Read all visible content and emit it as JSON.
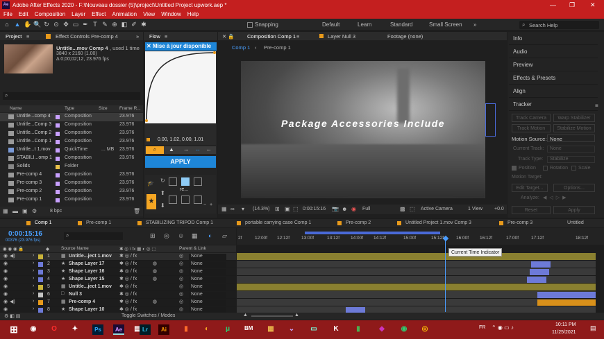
{
  "window": {
    "title": "Adobe After Effects 2020 - F:\\Nouveau dossier (5)\\project\\Untitled Project upwork.aep *"
  },
  "menu": [
    "File",
    "Edit",
    "Composition",
    "Layer",
    "Effect",
    "Animation",
    "View",
    "Window",
    "Help"
  ],
  "toolbar": {
    "snapping": "Snapping",
    "workspaces": [
      "Default",
      "Learn",
      "Standard",
      "Small Screen"
    ],
    "search_placeholder": "Search Help"
  },
  "project": {
    "tab": "Project",
    "effect_controls": "Effect Controls Pre-comp 4",
    "selected_name": "Untitle...mov Comp 4",
    "used": ", used 1 time",
    "dims": "3840 x 2160 (1.00)",
    "duration": "Δ 0;00;02;12, 23.976 fps",
    "columns": [
      "Name",
      "Type",
      "Size",
      "Frame R..."
    ],
    "items": [
      {
        "name": "Untitle...comp 4",
        "type": "Composition",
        "size": "",
        "fps": "23.976"
      },
      {
        "name": "Untitle...Comp 3",
        "type": "Composition",
        "size": "",
        "fps": "23.976"
      },
      {
        "name": "Untitle...Comp 2",
        "type": "Composition",
        "size": "",
        "fps": "23.976"
      },
      {
        "name": "Untitle...Comp 1",
        "type": "Composition",
        "size": "",
        "fps": "23.976"
      },
      {
        "name": "Untitle...t 1.mov",
        "type": "QuickTime",
        "size": "... MB",
        "fps": "23.976"
      },
      {
        "name": "STABILI...omp 1",
        "type": "Composition",
        "size": "",
        "fps": "23.976"
      },
      {
        "name": "Solids",
        "type": "Folder",
        "size": "",
        "fps": ""
      },
      {
        "name": "Pre-comp 4",
        "type": "Composition",
        "size": "",
        "fps": "23.976"
      },
      {
        "name": "Pre-comp 3",
        "type": "Composition",
        "size": "",
        "fps": "23.976"
      },
      {
        "name": "Pre-comp 2",
        "type": "Composition",
        "size": "",
        "fps": "23.976"
      },
      {
        "name": "Pre-comp 1",
        "type": "Composition",
        "size": "",
        "fps": "23.976"
      }
    ],
    "bpc": "8 bpc"
  },
  "flow": {
    "tab": "Flow",
    "banner": "Mise à jour disponible",
    "values": "0.00, 1.02, 0.00, 1.01",
    "apply": "APPLY",
    "thumb_label": "re..."
  },
  "viewer": {
    "comp_tab": "Composition Comp 1",
    "layer_tab": "Layer Null 3",
    "footage_tab": "Footage (none)",
    "sub_tabs": [
      "Comp 1",
      "Pre-comp 1"
    ],
    "overlay_text": "Package Accessories Include",
    "zoom": "(14.3%)",
    "timecode": "0:00:15:16",
    "quality": "Full",
    "camera": "Active Camera",
    "views": "1 View",
    "offset": "+0.0"
  },
  "right_panel": {
    "items": [
      "Info",
      "Audio",
      "Preview",
      "Effects & Presets",
      "Align",
      "Tracker"
    ],
    "tracker": {
      "buttons": [
        "Track Camera",
        "Warp Stabilizer",
        "Track Motion",
        "Stabilize Motion"
      ],
      "motion_source_label": "Motion Source:",
      "motion_source": "None",
      "current_track_label": "Current Track:",
      "current_track": "None",
      "track_type_label": "Track Type:",
      "track_type": "Stabilize",
      "checks": [
        "Position",
        "Rotation",
        "Scale"
      ],
      "motion_target": "Motion Target:",
      "edit_target": "Edit Target...",
      "options": "Options...",
      "analyze": "Analyze:",
      "reset": "Reset",
      "apply": "Apply"
    }
  },
  "timeline": {
    "tabs": [
      "Comp 1",
      "Pre-comp 1",
      "STABILIZING TRIPOD Comp 1",
      "portable carrying case Comp 1",
      "Pre-comp 2",
      "Untitled Project 1.mov Comp 3",
      "Pre-comp 3",
      "Untitled"
    ],
    "timecode": "0:00:15:16",
    "frames": "00376 (23.976 fps)",
    "col_source": "Source Name",
    "col_parent": "Parent & Link",
    "ruler": [
      "2f",
      "12:00f",
      "12:12f",
      "13:00f",
      "13:12f",
      "14:00f",
      "14:12f",
      "15:00f",
      "15:12f",
      "16:00f",
      "16:12f",
      "17:00f",
      "17:12f",
      "18:12f"
    ],
    "tooltip": "Current Time Indicator",
    "toggle": "Toggle Switches / Modes",
    "layers": [
      {
        "num": "1",
        "name": "Untitle...ject 1.mov",
        "color": "#c9b33a",
        "parent": "None"
      },
      {
        "num": "2",
        "name": "Shape Layer 17",
        "color": "#6d7ad8",
        "parent": "None"
      },
      {
        "num": "3",
        "name": "Shape Layer 16",
        "color": "#6d7ad8",
        "parent": "None"
      },
      {
        "num": "4",
        "name": "Shape Layer 15",
        "color": "#6d7ad8",
        "parent": "None"
      },
      {
        "num": "5",
        "name": "Untitle...ject 1.mov",
        "color": "#c9b33a",
        "parent": "None"
      },
      {
        "num": "6",
        "name": "Null 3",
        "color": "#c4c4c4",
        "parent": "None"
      },
      {
        "num": "7",
        "name": "Pre-comp 4",
        "color": "#e89a1b",
        "parent": "None"
      },
      {
        "num": "8",
        "name": "Shape Layer 10",
        "color": "#6d7ad8",
        "parent": "None"
      }
    ]
  },
  "taskbar": {
    "time": "10:11 PM",
    "date": "11/25/2021",
    "lang": "FR",
    "apps": [
      "Ps",
      "Ae",
      "Lr",
      "Ai",
      "BM"
    ]
  }
}
